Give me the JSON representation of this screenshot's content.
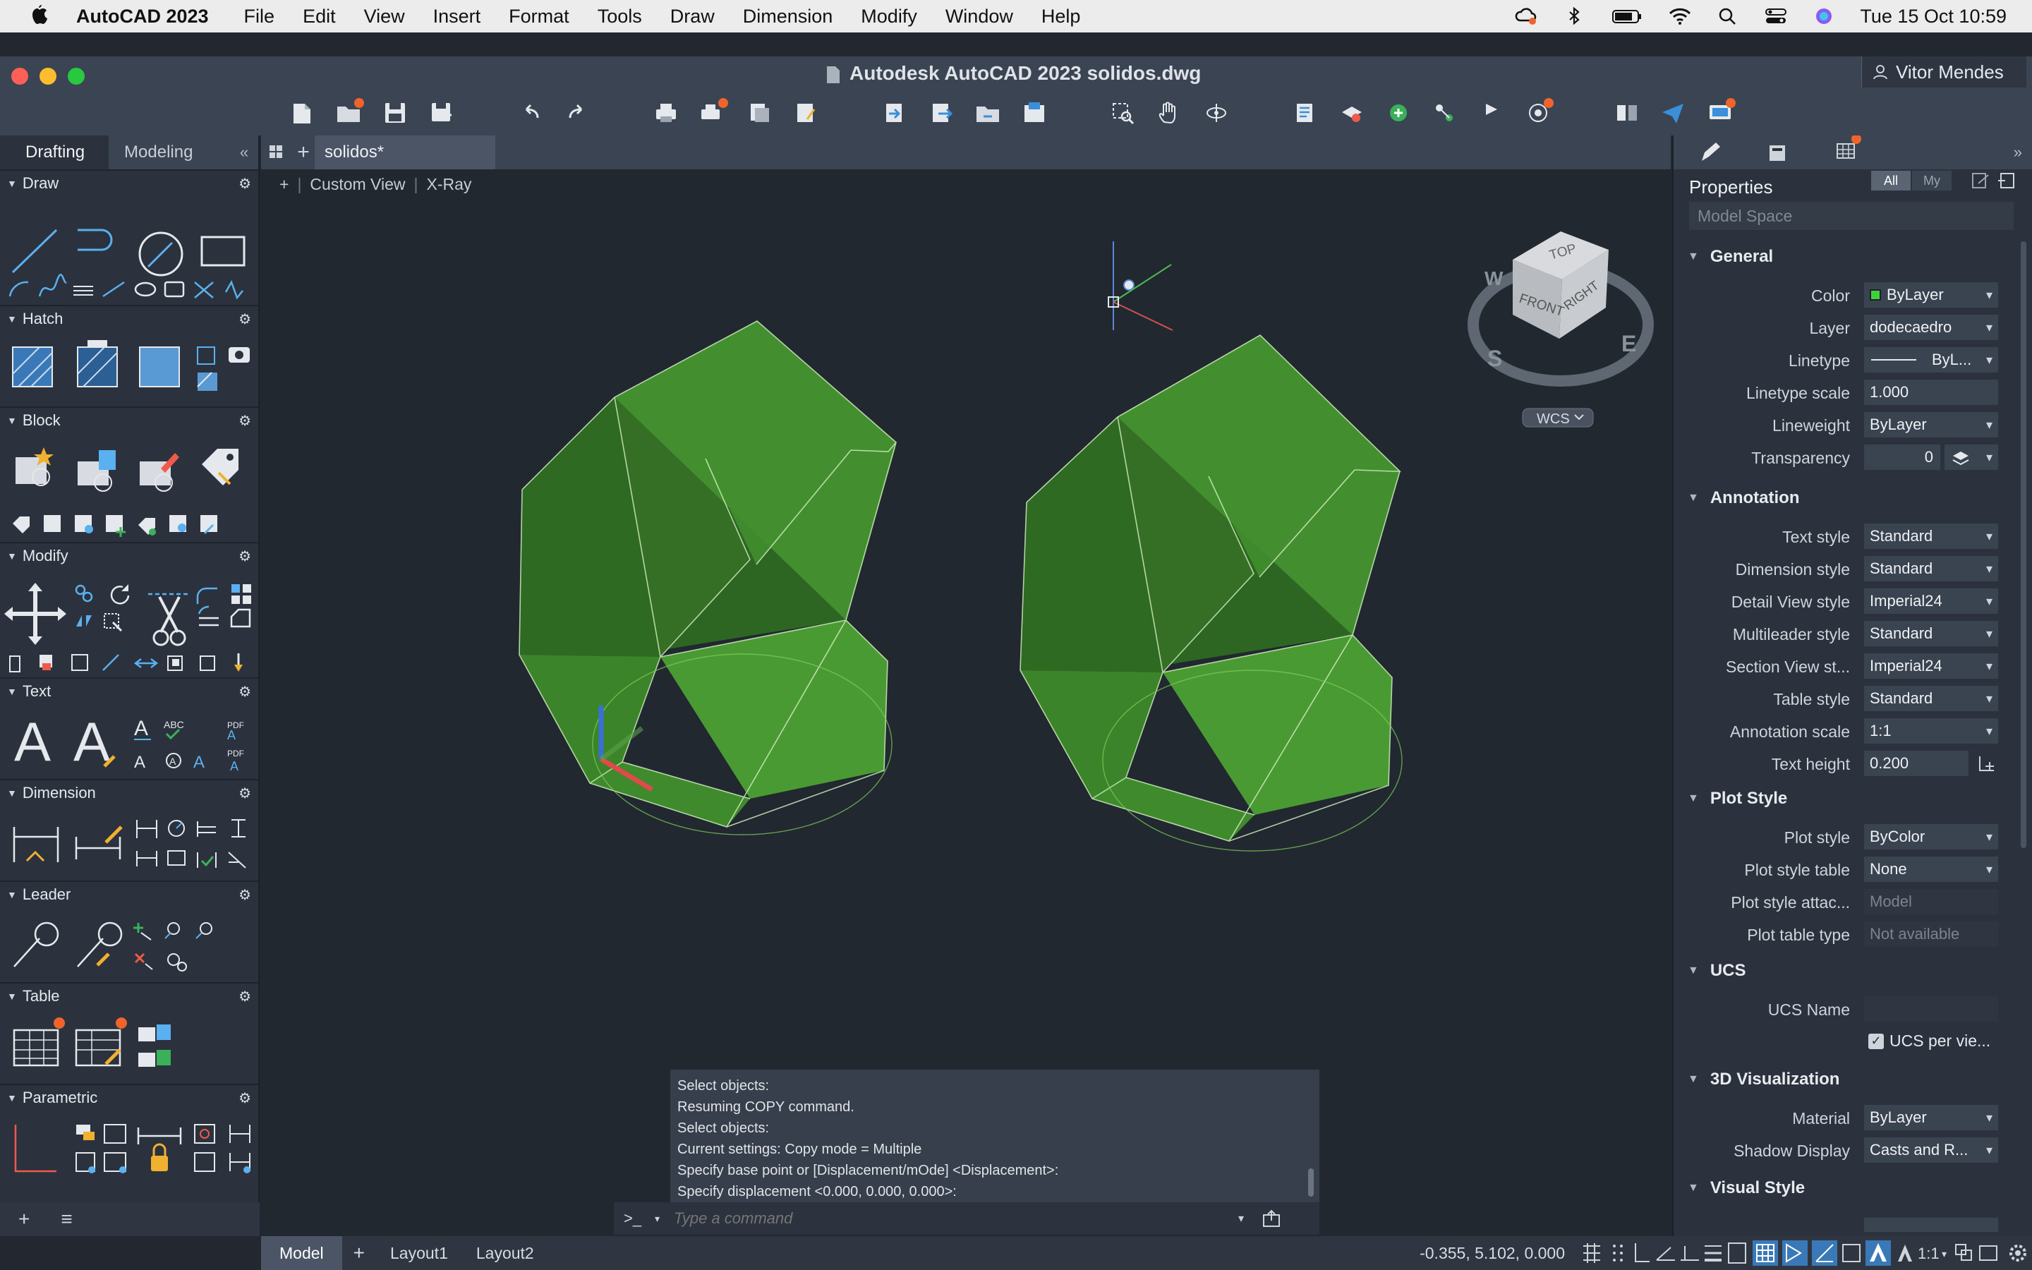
{
  "menubar": {
    "app_name": "AutoCAD 2023",
    "items": [
      "File",
      "Edit",
      "View",
      "Insert",
      "Format",
      "Tools",
      "Draw",
      "Dimension",
      "Modify",
      "Window",
      "Help"
    ],
    "clock": "Tue 15 Oct  10:59"
  },
  "window": {
    "title": "Autodesk AutoCAD 2023    solidos.dwg",
    "user": "Vitor Mendes"
  },
  "palette": {
    "tabs": [
      "Drafting",
      "Modeling"
    ],
    "sections": [
      "Draw",
      "Hatch",
      "Block",
      "Modify",
      "Text",
      "Dimension",
      "Leader",
      "Table",
      "Parametric"
    ]
  },
  "document": {
    "tab": "solidos*"
  },
  "viewport": {
    "view_name": "Custom View",
    "visual_style": "X-Ray",
    "viewcube": {
      "top": "TOP",
      "front": "FRONT",
      "right": "RIGHT",
      "s": "S",
      "e": "E",
      "w": "W"
    },
    "wcs": "WCS",
    "colors": {
      "solid": "#3f8a2c",
      "solid_dark": "#2f6b22",
      "solid_light": "#4a9a33",
      "edge": "#cdeabb"
    }
  },
  "command": {
    "history": [
      "Select objects:",
      "Resuming COPY command.",
      "Select objects:",
      "Current settings:  Copy mode = Multiple",
      "Specify base point or [Displacement/mOde] <Displacement>:",
      "Specify displacement <0.000, 0.000, 0.000>:"
    ],
    "prompt_icon": ">_",
    "placeholder": "Type a command"
  },
  "status": {
    "layouts": [
      "Model",
      "Layout1",
      "Layout2"
    ],
    "coordinates": "-0.355, 5.102, 0.000",
    "scale": "1:1"
  },
  "properties": {
    "title": "Properties",
    "filter_all": "All",
    "filter_my": "My",
    "space": "Model Space",
    "groups": {
      "general": "General",
      "annotation": "Annotation",
      "plot_style": "Plot Style",
      "ucs": "UCS",
      "visualization": "3D Visualization",
      "visual_style": "Visual Style"
    },
    "rows": {
      "color": {
        "label": "Color",
        "value": "ByLayer",
        "swatch": "#3fd13a"
      },
      "layer": {
        "label": "Layer",
        "value": "dodecaedro"
      },
      "linetype": {
        "label": "Linetype",
        "value": "ByL..."
      },
      "linetype_scale": {
        "label": "Linetype scale",
        "value": "1.000"
      },
      "lineweight": {
        "label": "Lineweight",
        "value": "ByLayer"
      },
      "transparency": {
        "label": "Transparency",
        "value": "0"
      },
      "text_style": {
        "label": "Text style",
        "value": "Standard"
      },
      "dimension_style": {
        "label": "Dimension style",
        "value": "Standard"
      },
      "detail_view_style": {
        "label": "Detail View style",
        "value": "Imperial24"
      },
      "multileader_style": {
        "label": "Multileader style",
        "value": "Standard"
      },
      "section_view_style": {
        "label": "Section View st...",
        "value": "Imperial24"
      },
      "table_style": {
        "label": "Table style",
        "value": "Standard"
      },
      "annotation_scale": {
        "label": "Annotation scale",
        "value": "1:1"
      },
      "text_height": {
        "label": "Text height",
        "value": "0.200"
      },
      "plot_style": {
        "label": "Plot style",
        "value": "ByColor"
      },
      "plot_style_table": {
        "label": "Plot style table",
        "value": "None"
      },
      "plot_style_attached": {
        "label": "Plot style attac...",
        "value": "Model"
      },
      "plot_table_type": {
        "label": "Plot table type",
        "value": "Not available"
      },
      "ucs_name": {
        "label": "UCS Name",
        "value": ""
      },
      "ucs_per_viewport": {
        "label": "UCS per vie..."
      },
      "material": {
        "label": "Material",
        "value": "ByLayer"
      },
      "shadow_display": {
        "label": "Shadow Display",
        "value": "Casts and R..."
      }
    }
  }
}
